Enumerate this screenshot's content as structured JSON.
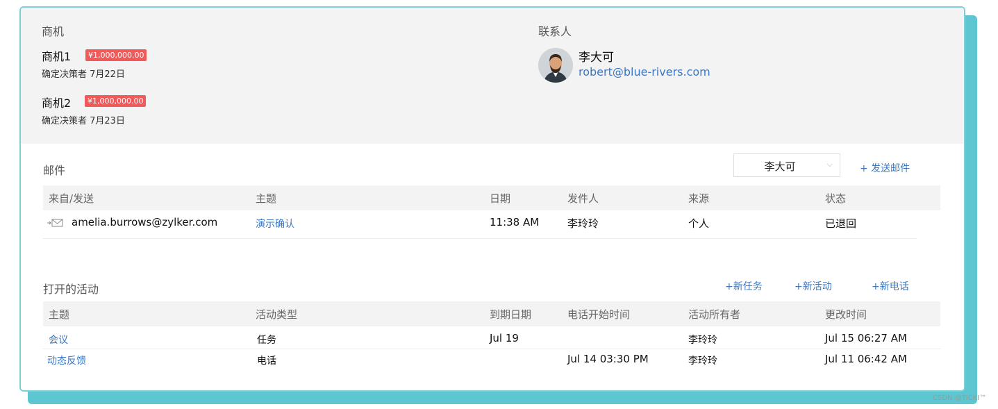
{
  "deals": {
    "section_title": "商机",
    "items": [
      {
        "name": "商机1",
        "amount": "¥1,000,000.00",
        "stage": "确定决策者 7月22日"
      },
      {
        "name": "商机2",
        "amount": "¥1,000,000.00",
        "stage": "确定决策者 7月23日"
      }
    ]
  },
  "contact": {
    "section_title": "联系人",
    "name": "李大可",
    "email": "robert@blue-rivers.com"
  },
  "emails": {
    "section_title": "邮件",
    "filter_value": "李大可",
    "send_label": "+ 发送邮件",
    "headers": [
      "来自/发送",
      "主题",
      "日期",
      "发件人",
      "来源",
      "状态"
    ],
    "rows": [
      {
        "from": "amelia.burrows@zylker.com",
        "subject": "演示确认",
        "date": "11:38 AM",
        "sender": "李玲玲",
        "source": "个人",
        "status": "已退回"
      }
    ]
  },
  "activities": {
    "section_title": "打开的活动",
    "actions": [
      "+新任务",
      "+新活动",
      "+新电话"
    ],
    "headers": [
      "主题",
      "活动类型",
      "到期日期",
      "电话开始时间",
      "活动所有者",
      "更改时间"
    ],
    "rows": [
      {
        "subject": "会议",
        "type": "任务",
        "due": "Jul 19",
        "call_start": "",
        "owner": "李玲玲",
        "modified": "Jul 15 06:27 AM"
      },
      {
        "subject": "动态反馈",
        "type": "电话",
        "due": "",
        "call_start": "Jul 14 03:30 PM",
        "owner": "李玲玲",
        "modified": "Jul 11 06:42 AM"
      }
    ]
  },
  "watermark": "CSDN @TICKI™",
  "colors": {
    "accent": "#3b78c4",
    "badge": "#f05a5a",
    "frame": "#5ec6d1"
  }
}
